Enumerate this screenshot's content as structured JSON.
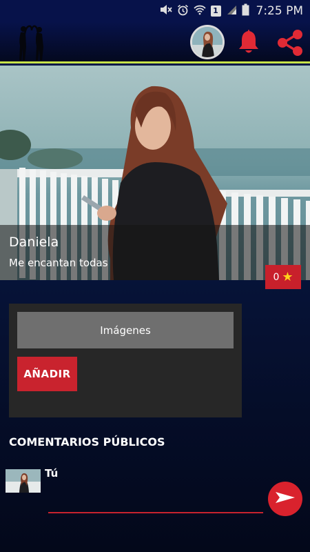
{
  "status_bar": {
    "time": "7:25 PM",
    "sim_slot": "1",
    "icons": [
      "mute-icon",
      "alarm-icon",
      "wifi-icon",
      "sim-icon",
      "signal-icon",
      "battery-icon"
    ]
  },
  "app_bar": {
    "logo_icon": "couple-heart-logo",
    "actions": [
      "profile-avatar",
      "bell-icon",
      "share-icon"
    ],
    "accent_color": "#c8e24a",
    "action_color": "#e02a35"
  },
  "profile": {
    "name": "Daniela",
    "status": "Me encantan todas",
    "rating": "0"
  },
  "images_panel": {
    "tab_label": "Imágenes",
    "add_label": "AÑADIR"
  },
  "comments": {
    "title": "COMENTARIOS PÚBLICOS",
    "current_user": "Tú",
    "input_value": "",
    "input_placeholder": ""
  }
}
